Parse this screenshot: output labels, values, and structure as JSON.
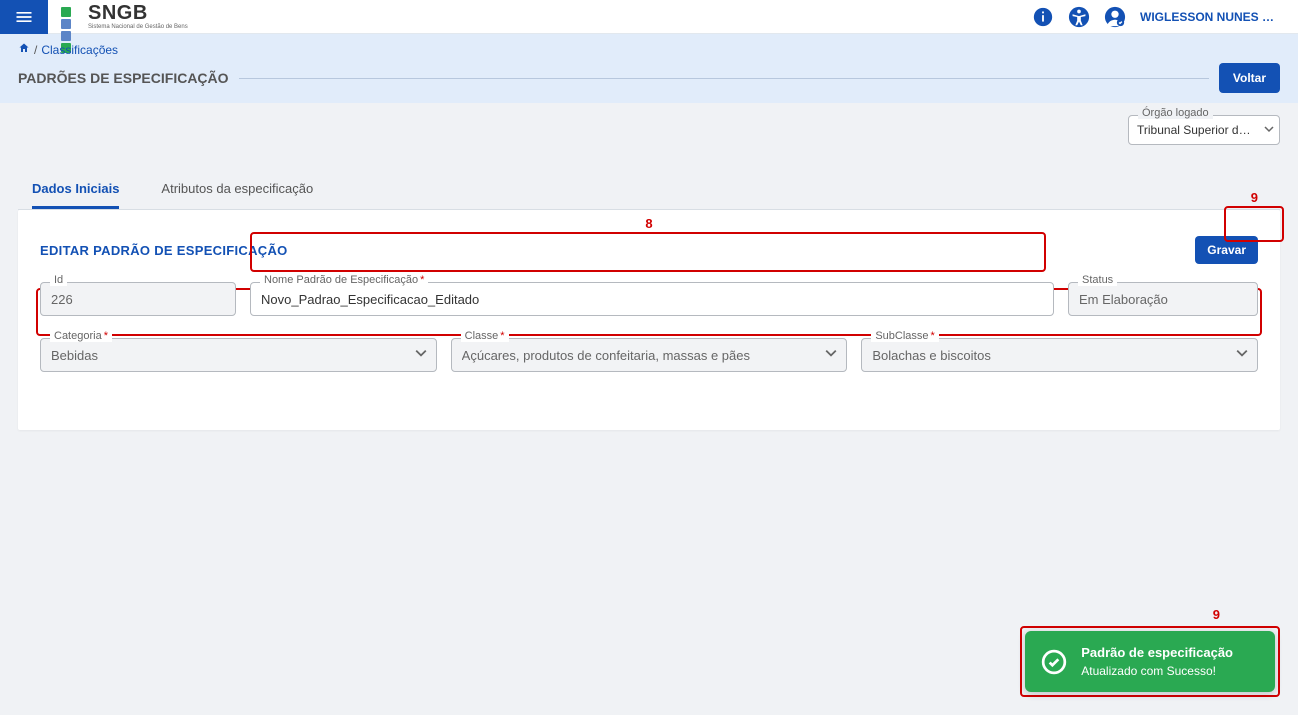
{
  "header": {
    "brand_main": "SNGB",
    "brand_sub": "Sistema Nacional de Gestão de Bens",
    "user_name": "WIGLESSON NUNES RO..."
  },
  "breadcrumb": {
    "home_icon": "home",
    "link": "Classificações",
    "separator": "/"
  },
  "page": {
    "title": "PADRÕES DE ESPECIFICAÇÃO",
    "back_button": "Voltar"
  },
  "org_select": {
    "label": "Órgão logado",
    "value": "Tribunal Superior do Tra..."
  },
  "tabs": [
    {
      "label": "Dados Iniciais",
      "active": true
    },
    {
      "label": "Atributos da especificação",
      "active": false
    }
  ],
  "form": {
    "section_title": "EDITAR PADRÃO DE ESPECIFICAÇÃO",
    "save_button": "Gravar",
    "fields": {
      "id": {
        "label": "Id",
        "value": "226"
      },
      "name": {
        "label": "Nome Padrão de Especificação",
        "value": "Novo_Padrao_Especificacao_Editado"
      },
      "status": {
        "label": "Status",
        "value": "Em Elaboração"
      },
      "categoria": {
        "label": "Categoria",
        "value": "Bebidas"
      },
      "classe": {
        "label": "Classe",
        "value": "Açúcares, produtos de confeitaria, massas e pães"
      },
      "subclasse": {
        "label": "SubClasse",
        "value": "Bolachas e biscoitos"
      }
    }
  },
  "annotations": {
    "a8": "8",
    "a9": "9"
  },
  "toast": {
    "title": "Padrão de especificação",
    "body": "Atualizado com Sucesso!"
  }
}
